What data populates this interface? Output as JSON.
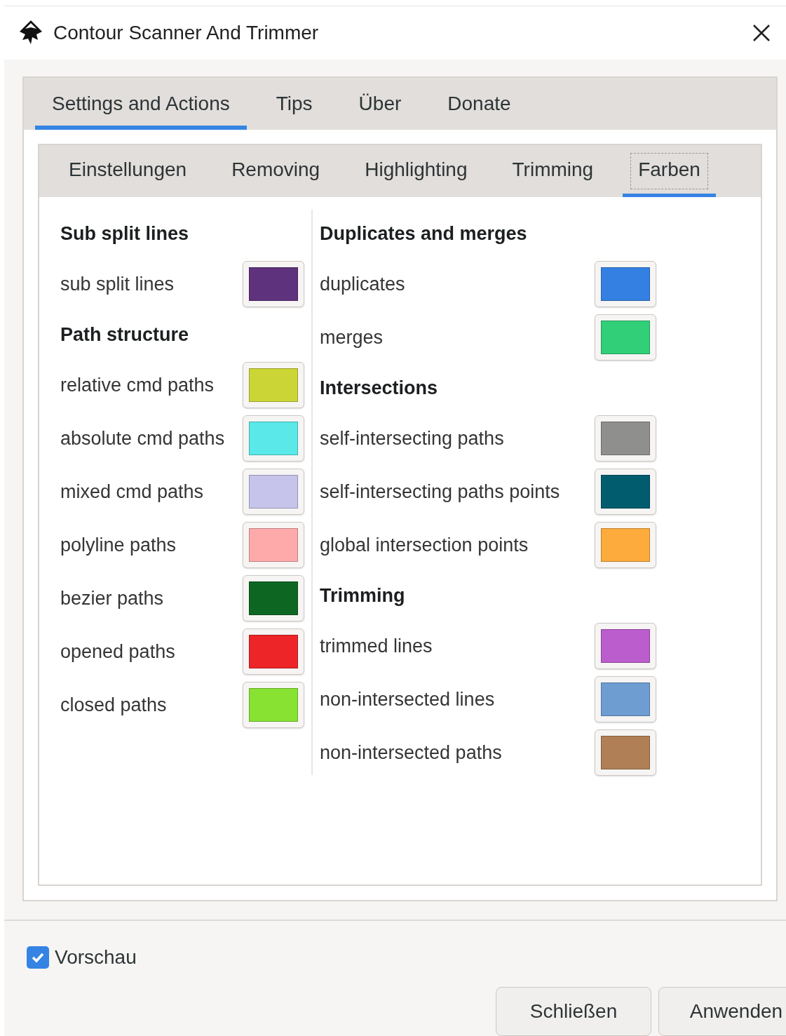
{
  "window": {
    "title": "Contour Scanner And Trimmer"
  },
  "tabs": [
    {
      "label": "Settings and Actions",
      "selected": true
    },
    {
      "label": "Tips",
      "selected": false
    },
    {
      "label": "Über",
      "selected": false
    },
    {
      "label": "Donate",
      "selected": false
    }
  ],
  "subtabs": [
    {
      "label": "Einstellungen",
      "selected": false
    },
    {
      "label": "Removing",
      "selected": false
    },
    {
      "label": "Highlighting",
      "selected": false
    },
    {
      "label": "Trimming",
      "selected": false
    },
    {
      "label": "Farben",
      "selected": true
    }
  ],
  "columns": [
    {
      "sections": [
        {
          "heading": "Sub split lines",
          "items": [
            {
              "label": "sub split lines",
              "color": "#5f327d"
            }
          ]
        },
        {
          "heading": "Path structure",
          "items": [
            {
              "label": "relative cmd paths",
              "color": "#cbd636"
            },
            {
              "label": "absolute cmd paths",
              "color": "#5ae8e8"
            },
            {
              "label": "mixed cmd paths",
              "color": "#c6c4ea"
            },
            {
              "label": "polyline paths",
              "color": "#ffaaaa"
            },
            {
              "label": "bezier paths",
              "color": "#0e6623"
            },
            {
              "label": "opened paths",
              "color": "#ee2528"
            },
            {
              "label": "closed paths",
              "color": "#87e232"
            }
          ]
        }
      ]
    },
    {
      "sections": [
        {
          "heading": "Duplicates and merges",
          "items": [
            {
              "label": "duplicates",
              "color": "#3480e2"
            },
            {
              "label": "merges",
              "color": "#30cf78"
            }
          ]
        },
        {
          "heading": "Intersections",
          "items": [
            {
              "label": "self-intersecting paths",
              "color": "#8f8f8d"
            },
            {
              "label": "self-intersecting paths points",
              "color": "#015c6e"
            },
            {
              "label": "global intersection points",
              "color": "#fcab3c"
            }
          ]
        },
        {
          "heading": "Trimming",
          "items": [
            {
              "label": "trimmed lines",
              "color": "#bb5dcc"
            },
            {
              "label": "non-intersected lines",
              "color": "#6e9dd2"
            },
            {
              "label": "non-intersected paths",
              "color": "#b07f55"
            }
          ]
        }
      ]
    }
  ],
  "preview": {
    "label": "Vorschau",
    "checked": true
  },
  "buttons": [
    "Schließen",
    "Anwenden"
  ]
}
